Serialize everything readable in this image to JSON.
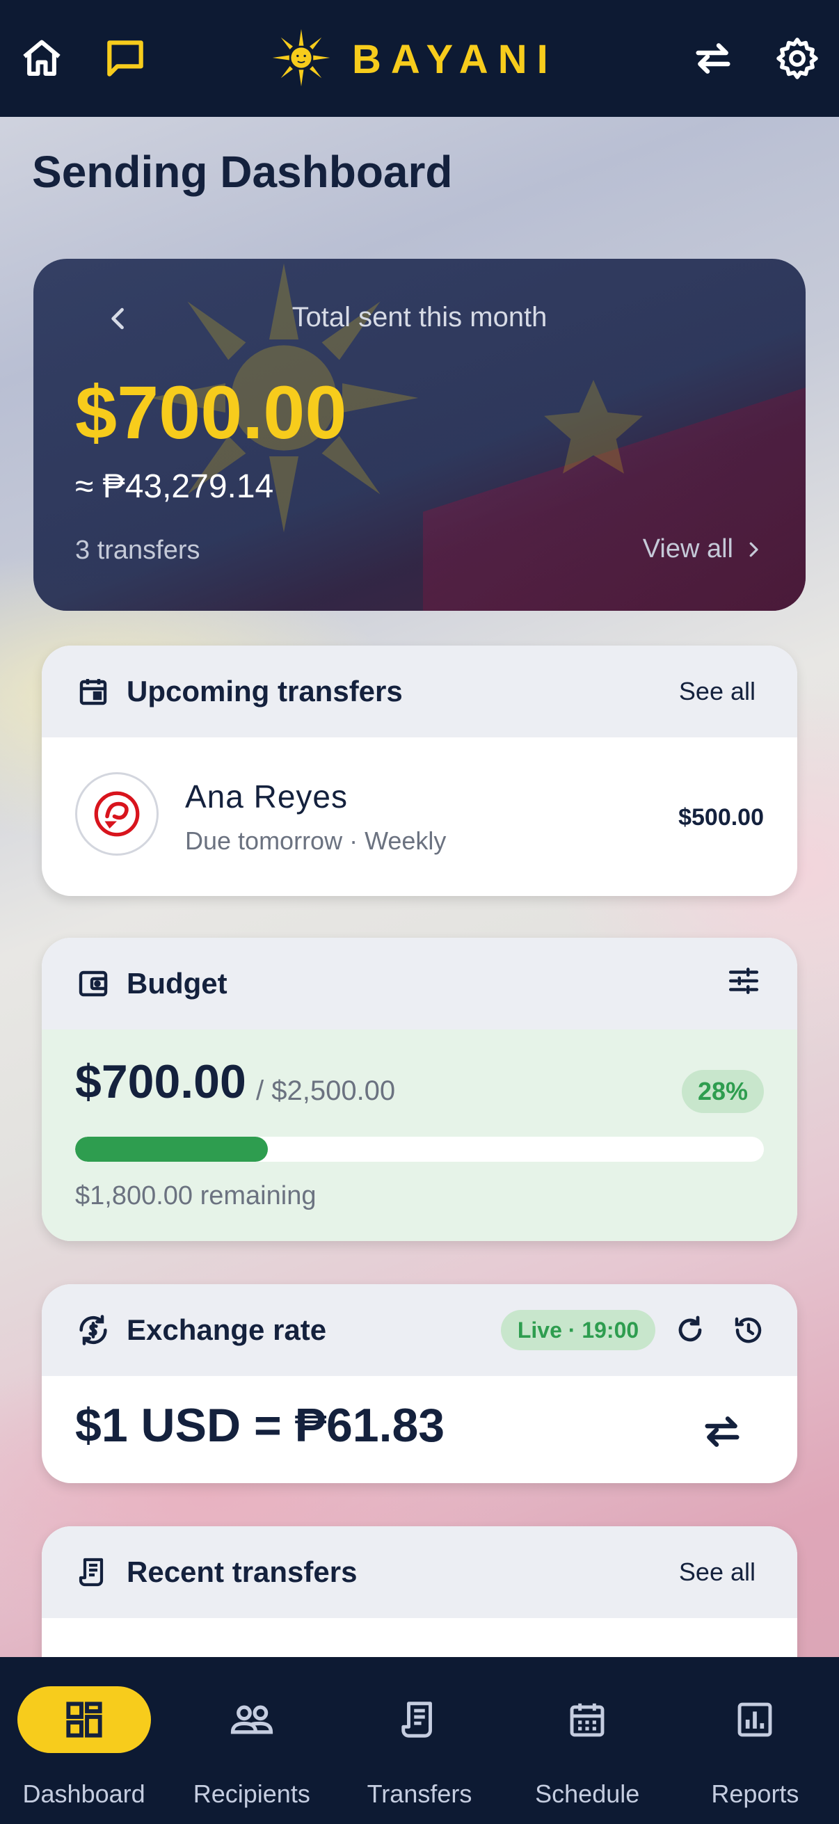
{
  "app": {
    "brand": "BAYANI",
    "colors": {
      "navy": "#0d1a33",
      "gold": "#f7cc1c",
      "green": "#2e9d4f"
    }
  },
  "topbar": {
    "icons": [
      "home-icon",
      "chat-icon",
      "swap-icon",
      "gear-icon"
    ]
  },
  "page": {
    "title": "Sending Dashboard"
  },
  "hero": {
    "label": "Total sent this month",
    "amount": "$700.00",
    "php_equiv": "≈ ₱43,279.14",
    "count": "3 transfers",
    "view_all": "View all"
  },
  "upcoming": {
    "title": "Upcoming transfers",
    "action": "See all",
    "item": {
      "name": "Ana Reyes",
      "sub": "Due tomorrow · Weekly",
      "amount": "$500.00"
    }
  },
  "budget": {
    "title": "Budget",
    "spent": "$700.00",
    "total": "/ $2,500.00",
    "percent_label": "28%",
    "progress_fraction": 0.28,
    "remaining": "$1,800.00 remaining"
  },
  "exchange": {
    "title": "Exchange rate",
    "live": "Live · 19:00",
    "rate": "$1 USD = ₱61.83"
  },
  "recent": {
    "title": "Recent transfers",
    "action": "See all"
  },
  "nav": {
    "items": [
      {
        "label": "Dashboard",
        "icon": "dashboard-icon",
        "active": true
      },
      {
        "label": "Recipients",
        "icon": "recipients-icon",
        "active": false
      },
      {
        "label": "Transfers",
        "icon": "transfers-icon",
        "active": false
      },
      {
        "label": "Schedule",
        "icon": "schedule-icon",
        "active": false
      },
      {
        "label": "Reports",
        "icon": "reports-icon",
        "active": false
      }
    ]
  }
}
